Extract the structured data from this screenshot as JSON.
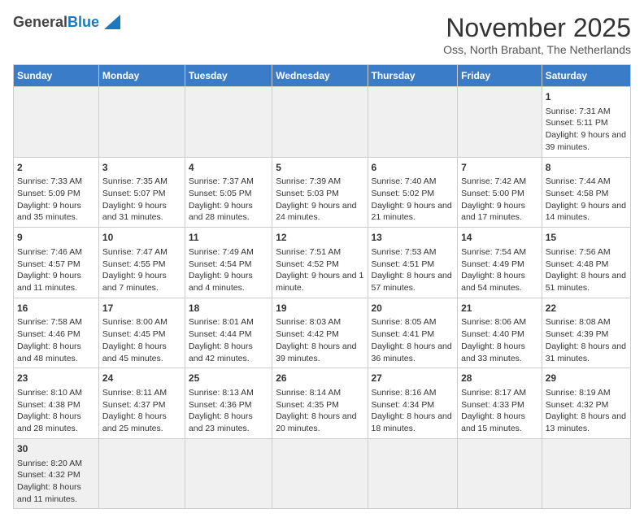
{
  "header": {
    "logo_general": "General",
    "logo_blue": "Blue",
    "month": "November 2025",
    "location": "Oss, North Brabant, The Netherlands"
  },
  "days_of_week": [
    "Sunday",
    "Monday",
    "Tuesday",
    "Wednesday",
    "Thursday",
    "Friday",
    "Saturday"
  ],
  "weeks": [
    {
      "cells": [
        {
          "day": "",
          "empty": true
        },
        {
          "day": "",
          "empty": true
        },
        {
          "day": "",
          "empty": true
        },
        {
          "day": "",
          "empty": true
        },
        {
          "day": "",
          "empty": true
        },
        {
          "day": "",
          "empty": true
        },
        {
          "day": "1",
          "sunrise": "Sunrise: 7:31 AM",
          "sunset": "Sunset: 5:11 PM",
          "daylight": "Daylight: 9 hours and 39 minutes."
        }
      ]
    },
    {
      "cells": [
        {
          "day": "2",
          "sunrise": "Sunrise: 7:33 AM",
          "sunset": "Sunset: 5:09 PM",
          "daylight": "Daylight: 9 hours and 35 minutes."
        },
        {
          "day": "3",
          "sunrise": "Sunrise: 7:35 AM",
          "sunset": "Sunset: 5:07 PM",
          "daylight": "Daylight: 9 hours and 31 minutes."
        },
        {
          "day": "4",
          "sunrise": "Sunrise: 7:37 AM",
          "sunset": "Sunset: 5:05 PM",
          "daylight": "Daylight: 9 hours and 28 minutes."
        },
        {
          "day": "5",
          "sunrise": "Sunrise: 7:39 AM",
          "sunset": "Sunset: 5:03 PM",
          "daylight": "Daylight: 9 hours and 24 minutes."
        },
        {
          "day": "6",
          "sunrise": "Sunrise: 7:40 AM",
          "sunset": "Sunset: 5:02 PM",
          "daylight": "Daylight: 9 hours and 21 minutes."
        },
        {
          "day": "7",
          "sunrise": "Sunrise: 7:42 AM",
          "sunset": "Sunset: 5:00 PM",
          "daylight": "Daylight: 9 hours and 17 minutes."
        },
        {
          "day": "8",
          "sunrise": "Sunrise: 7:44 AM",
          "sunset": "Sunset: 4:58 PM",
          "daylight": "Daylight: 9 hours and 14 minutes."
        }
      ]
    },
    {
      "cells": [
        {
          "day": "9",
          "sunrise": "Sunrise: 7:46 AM",
          "sunset": "Sunset: 4:57 PM",
          "daylight": "Daylight: 9 hours and 11 minutes."
        },
        {
          "day": "10",
          "sunrise": "Sunrise: 7:47 AM",
          "sunset": "Sunset: 4:55 PM",
          "daylight": "Daylight: 9 hours and 7 minutes."
        },
        {
          "day": "11",
          "sunrise": "Sunrise: 7:49 AM",
          "sunset": "Sunset: 4:54 PM",
          "daylight": "Daylight: 9 hours and 4 minutes."
        },
        {
          "day": "12",
          "sunrise": "Sunrise: 7:51 AM",
          "sunset": "Sunset: 4:52 PM",
          "daylight": "Daylight: 9 hours and 1 minute."
        },
        {
          "day": "13",
          "sunrise": "Sunrise: 7:53 AM",
          "sunset": "Sunset: 4:51 PM",
          "daylight": "Daylight: 8 hours and 57 minutes."
        },
        {
          "day": "14",
          "sunrise": "Sunrise: 7:54 AM",
          "sunset": "Sunset: 4:49 PM",
          "daylight": "Daylight: 8 hours and 54 minutes."
        },
        {
          "day": "15",
          "sunrise": "Sunrise: 7:56 AM",
          "sunset": "Sunset: 4:48 PM",
          "daylight": "Daylight: 8 hours and 51 minutes."
        }
      ]
    },
    {
      "cells": [
        {
          "day": "16",
          "sunrise": "Sunrise: 7:58 AM",
          "sunset": "Sunset: 4:46 PM",
          "daylight": "Daylight: 8 hours and 48 minutes."
        },
        {
          "day": "17",
          "sunrise": "Sunrise: 8:00 AM",
          "sunset": "Sunset: 4:45 PM",
          "daylight": "Daylight: 8 hours and 45 minutes."
        },
        {
          "day": "18",
          "sunrise": "Sunrise: 8:01 AM",
          "sunset": "Sunset: 4:44 PM",
          "daylight": "Daylight: 8 hours and 42 minutes."
        },
        {
          "day": "19",
          "sunrise": "Sunrise: 8:03 AM",
          "sunset": "Sunset: 4:42 PM",
          "daylight": "Daylight: 8 hours and 39 minutes."
        },
        {
          "day": "20",
          "sunrise": "Sunrise: 8:05 AM",
          "sunset": "Sunset: 4:41 PM",
          "daylight": "Daylight: 8 hours and 36 minutes."
        },
        {
          "day": "21",
          "sunrise": "Sunrise: 8:06 AM",
          "sunset": "Sunset: 4:40 PM",
          "daylight": "Daylight: 8 hours and 33 minutes."
        },
        {
          "day": "22",
          "sunrise": "Sunrise: 8:08 AM",
          "sunset": "Sunset: 4:39 PM",
          "daylight": "Daylight: 8 hours and 31 minutes."
        }
      ]
    },
    {
      "cells": [
        {
          "day": "23",
          "sunrise": "Sunrise: 8:10 AM",
          "sunset": "Sunset: 4:38 PM",
          "daylight": "Daylight: 8 hours and 28 minutes."
        },
        {
          "day": "24",
          "sunrise": "Sunrise: 8:11 AM",
          "sunset": "Sunset: 4:37 PM",
          "daylight": "Daylight: 8 hours and 25 minutes."
        },
        {
          "day": "25",
          "sunrise": "Sunrise: 8:13 AM",
          "sunset": "Sunset: 4:36 PM",
          "daylight": "Daylight: 8 hours and 23 minutes."
        },
        {
          "day": "26",
          "sunrise": "Sunrise: 8:14 AM",
          "sunset": "Sunset: 4:35 PM",
          "daylight": "Daylight: 8 hours and 20 minutes."
        },
        {
          "day": "27",
          "sunrise": "Sunrise: 8:16 AM",
          "sunset": "Sunset: 4:34 PM",
          "daylight": "Daylight: 8 hours and 18 minutes."
        },
        {
          "day": "28",
          "sunrise": "Sunrise: 8:17 AM",
          "sunset": "Sunset: 4:33 PM",
          "daylight": "Daylight: 8 hours and 15 minutes."
        },
        {
          "day": "29",
          "sunrise": "Sunrise: 8:19 AM",
          "sunset": "Sunset: 4:32 PM",
          "daylight": "Daylight: 8 hours and 13 minutes."
        }
      ]
    },
    {
      "cells": [
        {
          "day": "30",
          "sunrise": "Sunrise: 8:20 AM",
          "sunset": "Sunset: 4:32 PM",
          "daylight": "Daylight: 8 hours and 11 minutes."
        },
        {
          "day": "",
          "empty": true
        },
        {
          "day": "",
          "empty": true
        },
        {
          "day": "",
          "empty": true
        },
        {
          "day": "",
          "empty": true
        },
        {
          "day": "",
          "empty": true
        },
        {
          "day": "",
          "empty": true
        }
      ]
    }
  ]
}
